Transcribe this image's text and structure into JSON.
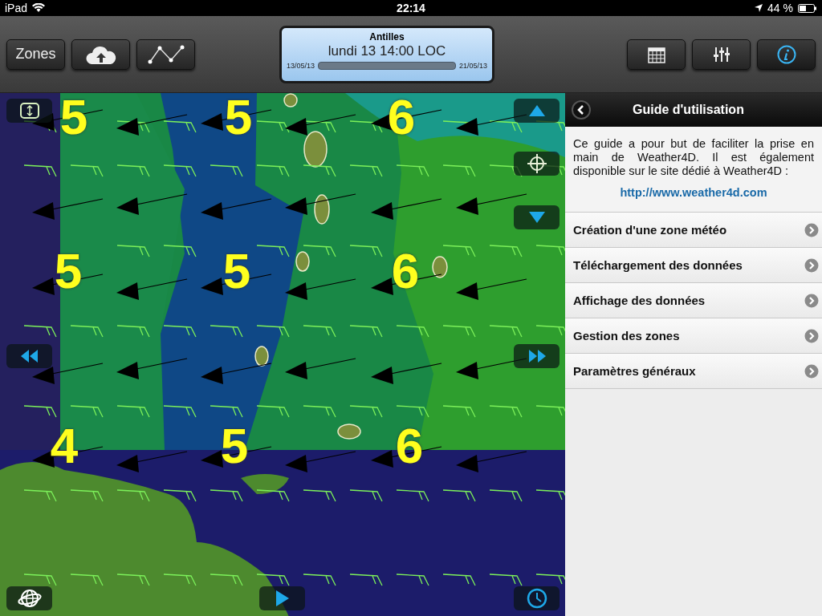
{
  "status_bar": {
    "device": "iPad",
    "time": "22:14",
    "battery": "44 %"
  },
  "toolbar": {
    "zones_button": "Zones",
    "right_buttons": [
      {
        "kind": "calendar",
        "selected": false
      },
      {
        "kind": "sliders",
        "selected": false
      },
      {
        "kind": "info",
        "selected": true
      }
    ]
  },
  "forecast": {
    "region": "Antilles",
    "time": "lundi 13 14:00 LOC",
    "start_date": "13/05/13",
    "end_date": "21/05/13",
    "level": 0
  },
  "map": {
    "wind_labels": [
      "5",
      "5",
      "6",
      "5",
      "5",
      "6",
      "4",
      "5",
      "6"
    ]
  },
  "guide": {
    "title": "Guide d'utilisation",
    "intro": "Ce guide a pour but de faciliter la prise en main de Weather4D. Il est également disponible sur le site dédié à Weather4D :",
    "link": "http://www.weather4d.com",
    "items": [
      "Création d'une zone météo",
      "Téléchargement des données",
      "Affichage des données",
      "Gestion des zones",
      "Paramètres généraux"
    ]
  }
}
